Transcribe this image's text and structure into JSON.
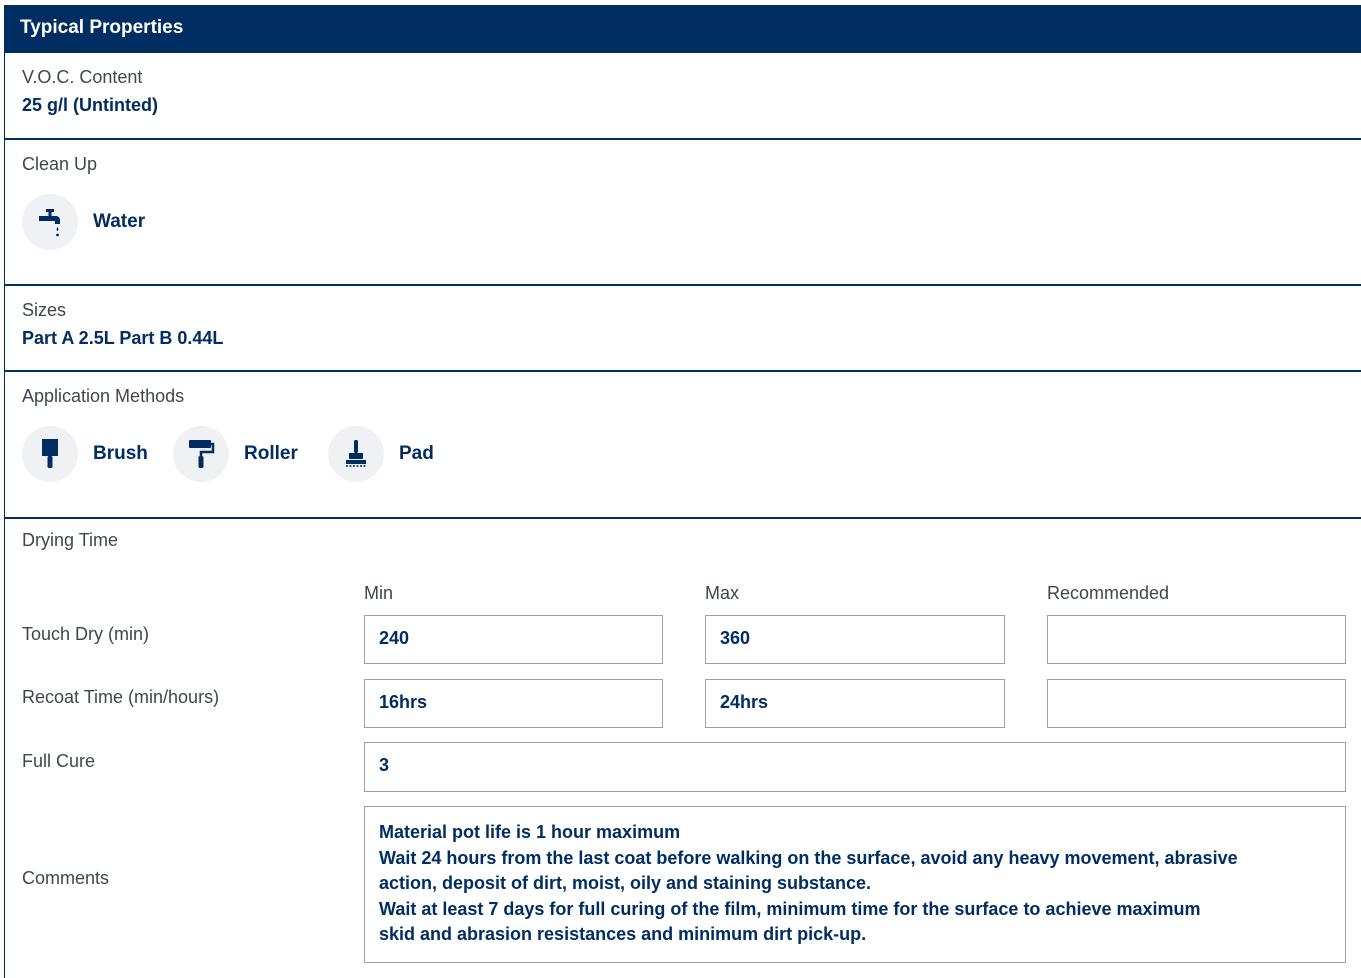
{
  "header": {
    "title": "Typical Properties"
  },
  "voc": {
    "label": "V.O.C. Content",
    "value": "25 g/l (Untinted)"
  },
  "cleanup": {
    "label": "Clean Up",
    "items": [
      {
        "icon": "tap-icon",
        "label": "Water"
      }
    ]
  },
  "sizes": {
    "label": "Sizes",
    "value": "Part A 2.5L Part B 0.44L"
  },
  "application": {
    "label": "Application Methods",
    "methods": [
      {
        "icon": "brush-icon",
        "label": "Brush"
      },
      {
        "icon": "roller-icon",
        "label": "Roller"
      },
      {
        "icon": "pad-icon",
        "label": "Pad"
      }
    ]
  },
  "drying": {
    "label": "Drying Time",
    "columns": [
      "Min",
      "Max",
      "Recommended"
    ],
    "rows": [
      {
        "label": "Touch Dry (min)",
        "min": "240",
        "max": "360",
        "recommended": ""
      },
      {
        "label": "Recoat Time (min/hours)",
        "min": "16hrs",
        "max": "24hrs",
        "recommended": ""
      }
    ],
    "full_cure": {
      "label": "Full Cure",
      "value": "3"
    },
    "comments": {
      "label": "Comments",
      "lines": [
        "Material pot life is 1 hour maximum",
        "Wait 24 hours from the last coat before walking on the surface, avoid any heavy movement, abrasive",
        "action, deposit of dirt, moist, oily and staining substance.",
        "Wait at least 7 days for full curing of the film, minimum time for the surface to achieve maximum",
        "skid and abrasion resistances and minimum dirt pick-up."
      ]
    }
  },
  "colors": {
    "brand": "#002d62",
    "icon_bg": "#f0f1f4",
    "label_text": "#3f4650",
    "box_border": "#9aa0a6"
  }
}
